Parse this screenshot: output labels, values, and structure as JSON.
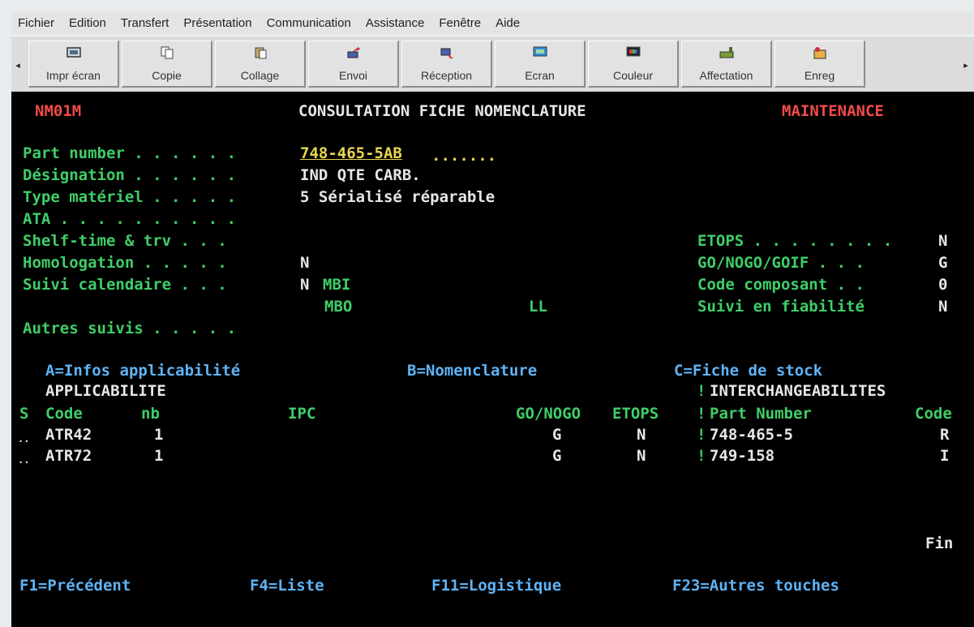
{
  "menu": [
    "Fichier",
    "Edition",
    "Transfert",
    "Présentation",
    "Communication",
    "Assistance",
    "Fenêtre",
    "Aide"
  ],
  "toolbar": {
    "buttons": [
      {
        "label": "Impr écran",
        "icon": "print-screen-icon"
      },
      {
        "label": "Copie",
        "icon": "copy-icon"
      },
      {
        "label": "Collage",
        "icon": "paste-icon"
      },
      {
        "label": "Envoi",
        "icon": "send-icon"
      },
      {
        "label": "Réception",
        "icon": "receive-icon"
      },
      {
        "label": "Ecran",
        "icon": "screen-icon"
      },
      {
        "label": "Couleur",
        "icon": "color-icon"
      },
      {
        "label": "Affectation",
        "icon": "assignment-icon"
      },
      {
        "label": "Enreg",
        "icon": "record-icon"
      }
    ],
    "left_arrow": "◂",
    "right_arrow": "▸"
  },
  "screen": {
    "program_id": "NM01M",
    "title": "CONSULTATION FICHE NOMENCLATURE",
    "mode": "MAINTENANCE",
    "fields": {
      "part_number": {
        "label": "Part number . . . . . .",
        "value": "748-465-5AB",
        "filler": "......."
      },
      "designation": {
        "label": "Désignation . . . . . .",
        "value": "IND QTE CARB."
      },
      "type_materiel": {
        "label": "Type matériel . . . . .",
        "value": "5 Sérialisé réparable"
      },
      "ata": {
        "label": "ATA . . . . . . . . . .",
        "value": ""
      },
      "shelf_time": {
        "label": "Shelf-time & trv . . .",
        "value": ""
      },
      "homologation": {
        "label": "Homologation . . . . .",
        "value": "N"
      },
      "suivi_calendaire": {
        "label": "Suivi calendaire . . .",
        "value": "N",
        "extra": "MBI"
      },
      "mbo": {
        "label": "MBO"
      },
      "ll": {
        "label": "LL"
      },
      "autres_suivis": {
        "label": "Autres suivis . . . . ."
      },
      "etops": {
        "label": "ETOPS . . . . . . . .",
        "value": "N"
      },
      "gonogo": {
        "label": "GO/NOGO/GOIF . . .",
        "value": "G"
      },
      "code_composant": {
        "label": "Code composant . .",
        "value": "0"
      },
      "suivi_fiabilite": {
        "label": "Suivi en fiabilité",
        "value": "N"
      }
    },
    "options": {
      "a": "A=Infos applicabilité",
      "b": "B=Nomenclature",
      "c": "C=Fiche de stock"
    },
    "applicability": {
      "title": "APPLICABILITE",
      "headers": {
        "s": "S",
        "code": "Code",
        "nb": "nb",
        "ipc": "IPC",
        "gonogo": "GO/NOGO",
        "etops": "ETOPS"
      },
      "rows": [
        {
          "sel": "..",
          "code": "ATR42",
          "nb": "1",
          "ipc": "",
          "gonogo": "G",
          "etops": "N"
        },
        {
          "sel": "..",
          "code": "ATR72",
          "nb": "1",
          "ipc": "",
          "gonogo": "G",
          "etops": "N"
        }
      ]
    },
    "interchangeability": {
      "title": "INTERCHANGEABILITES",
      "separator": "!",
      "headers": {
        "part_number": "Part Number",
        "code": "Code"
      },
      "rows": [
        {
          "part_number": "748-465-5",
          "code": "R"
        },
        {
          "part_number": "749-158",
          "code": "I"
        }
      ]
    },
    "end_marker": "Fin",
    "function_keys": [
      "F1=Précédent",
      "F4=Liste",
      "F11=Logistique",
      "F23=Autres touches"
    ]
  },
  "colors": {
    "screen_bg": "#000000",
    "label_green": "#3fce68",
    "input_yellow": "#e8d64c",
    "value_white": "#e6e6e6",
    "alert_red": "#f24a4a",
    "option_blue": "#5fb3f5"
  }
}
